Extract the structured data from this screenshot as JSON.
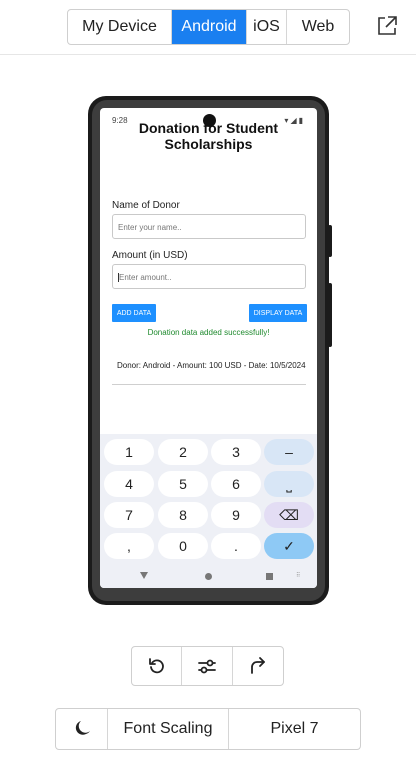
{
  "platform_tabs": [
    {
      "label": "My Device",
      "active": false
    },
    {
      "label": "Android",
      "active": true
    },
    {
      "label": "iOS",
      "active": false
    },
    {
      "label": "Web",
      "active": false
    }
  ],
  "accent_color": "#1a7ff0",
  "external_icon": "external-link-icon",
  "device": {
    "status_time": "9:28",
    "status_icons": [
      "wifi-icon",
      "signal-icon",
      "battery-icon"
    ],
    "app": {
      "title": "Donation for Student Scholarships",
      "donor_label": "Name of Donor",
      "donor_placeholder": "Enter your name..",
      "amount_label": "Amount (in USD)",
      "amount_placeholder": "Enter amount..",
      "add_button": "ADD DATA",
      "display_button": "DISPLAY DATA",
      "success_message": "Donation data added successfully!",
      "success_color": "#1f8a2e",
      "record": "Donor: Android - Amount: 100 USD - Date: 10/5/2024"
    },
    "keyboard": {
      "rows": [
        [
          "1",
          "2",
          "3",
          "–"
        ],
        [
          "4",
          "5",
          "6",
          "⎵"
        ],
        [
          "7",
          "8",
          "9",
          "⌫"
        ],
        [
          ",",
          "0",
          ".",
          "✓"
        ]
      ]
    }
  },
  "toolbar": {
    "icons": [
      "rotate-icon",
      "settings-sliders-icon",
      "forward-icon"
    ]
  },
  "bottom_bar": {
    "theme_icon": "moon-icon",
    "font_scaling": "Font Scaling",
    "device_name": "Pixel 7"
  }
}
